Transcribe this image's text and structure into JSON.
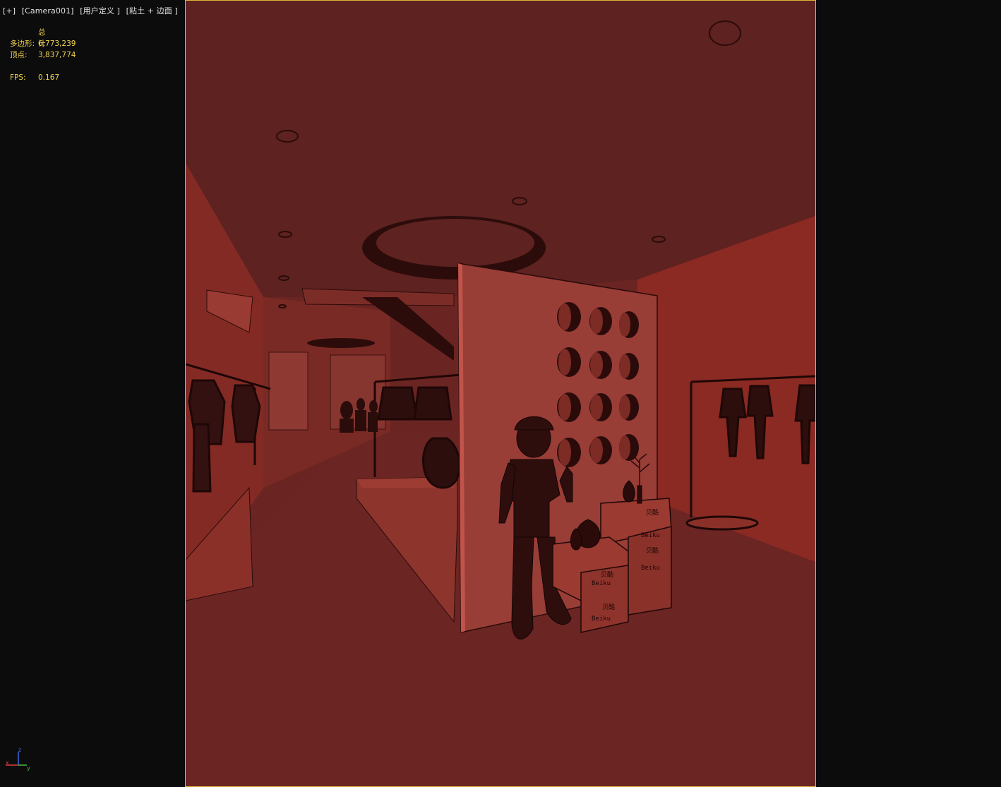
{
  "viewport": {
    "labels": [
      "[+]",
      "[Camera001]",
      "[用户定义 ]",
      "[粘土 + 边面 ]"
    ]
  },
  "stats": {
    "header": "总计",
    "polygons_label": "多边形:",
    "polygons_value": "6,773,239",
    "vertices_label": "顶点:",
    "vertices_value": "3,837,774",
    "fps_label": "FPS:",
    "fps_value": "0.167"
  },
  "scene": {
    "description_visible": false,
    "box_labels": [
      "贝酷",
      "Beiku",
      "贝酷",
      "Beiku",
      "贝酷",
      "Beiku",
      "贝酷",
      "Beiku"
    ]
  },
  "gizmo": {
    "axes": [
      "z",
      "x",
      "y"
    ]
  },
  "colors": {
    "background": "#0c0c0d",
    "frame_border": "#e0b43a",
    "stats_text": "#f0d250",
    "label_text": "#e6e6e6",
    "clay": "#6a2522"
  }
}
